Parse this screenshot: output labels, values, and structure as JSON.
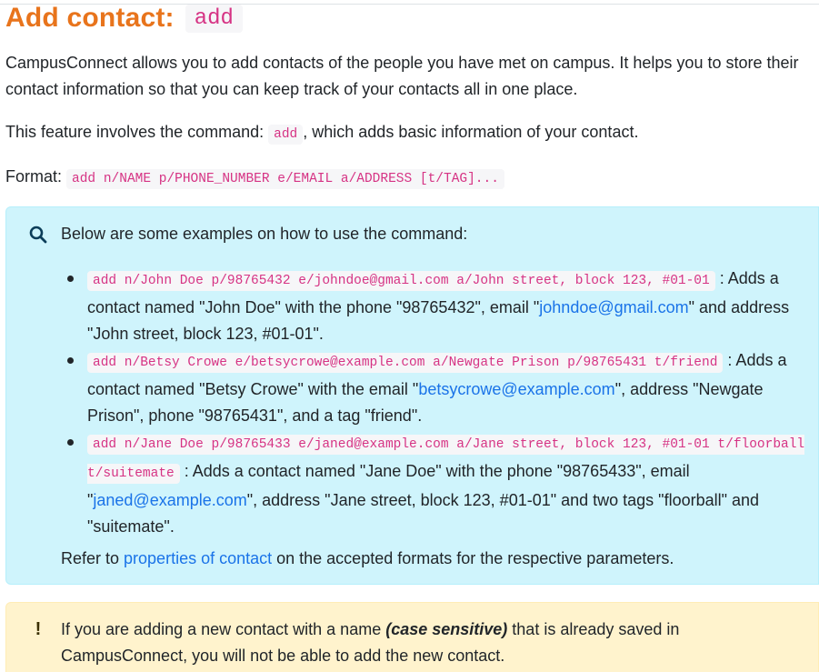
{
  "heading": {
    "title": "Add contact:",
    "command": "add"
  },
  "intro": "CampusConnect allows you to add contacts of the people you have met on campus. It helps you to store their contact information so that you can keep track of your contacts all in one place.",
  "feature": {
    "prefix": "This feature involves the command:",
    "command": "add",
    "suffix": ", which adds basic information of your contact."
  },
  "format": {
    "label": "Format:",
    "code": "add n/NAME p/PHONE_NUMBER e/EMAIL a/ADDRESS [t/TAG]..."
  },
  "info_box": {
    "icon": "search-icon",
    "intro": "Below are some examples on how to use the command:",
    "examples": [
      {
        "code": "add n/John Doe p/98765432 e/johndoe@gmail.com a/John street, block 123, #01-01",
        "t1": " : Adds a contact named \"John Doe\" with the phone \"98765432\", email \"",
        "link": "johndoe@gmail.com",
        "t2": "\" and address \"John street, block 123, #01-01\"."
      },
      {
        "code": "add n/Betsy Crowe e/betsycrowe@example.com a/Newgate Prison p/98765431 t/friend",
        "t1": " : Adds a contact named \"Betsy Crowe\" with the email \"",
        "link": "betsycrowe@example.com",
        "t2": "\", address \"Newgate Prison\", phone \"98765431\", and a tag \"friend\"."
      },
      {
        "code": "add n/Jane Doe p/98765433 e/janed@example.com a/Jane street, block 123, #01-01 t/floorball t/suitemate",
        "t1": " : Adds a contact named \"Jane Doe\" with the phone \"98765433\", email \"",
        "link": "janed@example.com",
        "t2": "\", address \"Jane street, block 123, #01-01\" and two tags \"floorball\" and \"suitemate\"."
      }
    ],
    "refer_prefix": "Refer to ",
    "refer_link": "properties of contact",
    "refer_suffix": " on the accepted formats for the respective parameters."
  },
  "warn_box": {
    "icon": "exclamation-icon",
    "glyph": "!",
    "t1": "If you are adding a new contact with a name ",
    "em": "(case sensitive)",
    "t2": " that is already saved in CampusConnect, you will not be able to add the new contact."
  },
  "colors": {
    "heading": "#e8741c",
    "code": "#d63384",
    "link": "#1a73e8",
    "info_bg": "#cff4fc",
    "warn_bg": "#fff3cd"
  }
}
